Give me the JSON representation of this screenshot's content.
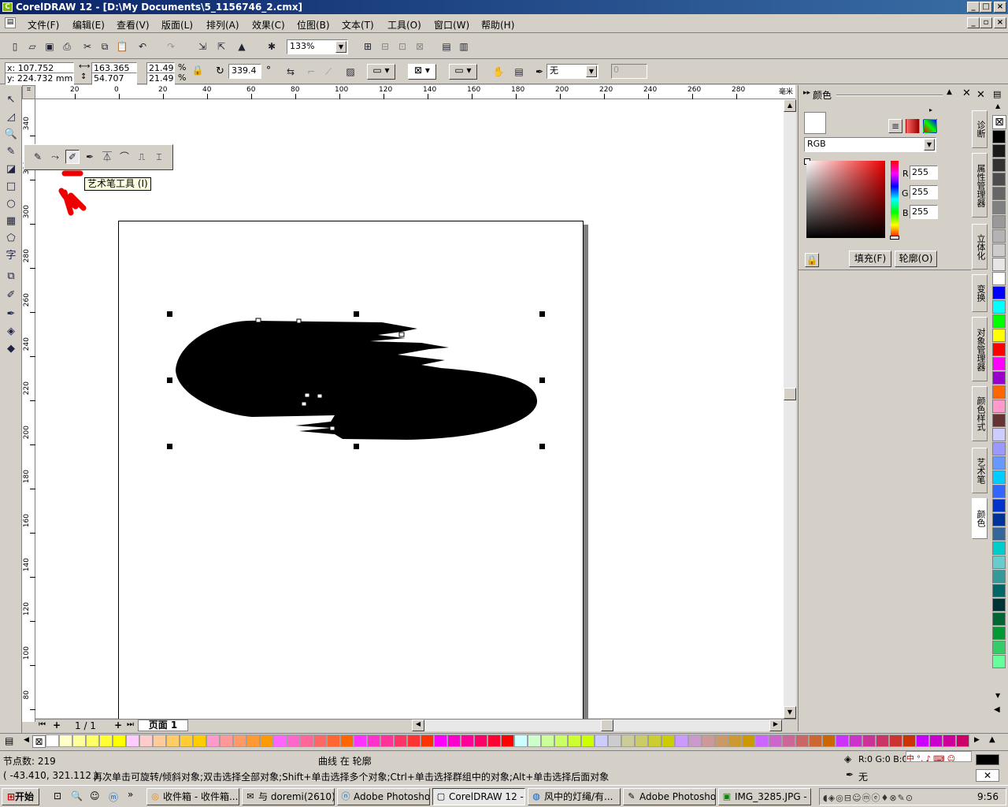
{
  "window": {
    "title": "CorelDRAW 12 - [D:\\My Documents\\5_1156746_2.cmx]"
  },
  "menu": [
    "文件(F)",
    "编辑(E)",
    "查看(V)",
    "版面(L)",
    "排列(A)",
    "效果(C)",
    "位图(B)",
    "文本(T)",
    "工具(O)",
    "窗口(W)",
    "帮助(H)"
  ],
  "toolbar": {
    "zoom": "133%"
  },
  "propbar": {
    "x": "x: 107.752 mm",
    "y": "y: 224.732 mm",
    "w": "163.365 mm",
    "h": "54.707 mm",
    "sx": "21.49",
    "sy": "21.49",
    "pct1": "%",
    "pct2": "%",
    "angle": "339.4",
    "deg": "°",
    "outline": "无",
    "disabled_val": "0"
  },
  "ruler": {
    "unit": "毫米",
    "h_ticks": [
      "20",
      "0",
      "20",
      "40",
      "60",
      "80",
      "100",
      "120",
      "140",
      "160",
      "180",
      "200",
      "220",
      "240",
      "260",
      "280"
    ],
    "v_ticks": [
      "340",
      "320",
      "300",
      "280",
      "260",
      "240",
      "220",
      "200",
      "180",
      "160",
      "140",
      "120",
      "100",
      "80"
    ]
  },
  "tooltip": "艺术笔工具 (I)",
  "page_nav": {
    "count": "1 / 1",
    "tab": "页面 1"
  },
  "docker": {
    "title": "颜色",
    "model": "RGB",
    "r_label": "R",
    "g_label": "G",
    "b_label": "B",
    "r": "255",
    "g": "255",
    "b": "255",
    "fill_btn": "填充(F)",
    "outline_btn": "轮廓(O)"
  },
  "dock_tabs": [
    "诊断",
    "属性管理器",
    "立体化",
    "变换",
    "对象管理器",
    "颜色样式",
    "艺术笔",
    "颜色"
  ],
  "status": {
    "nodes": "节点数: 219",
    "object": "曲线 在 轮廓",
    "coords": "( -43.410, 321.112 )",
    "hint": "再次单击可旋转/倾斜对象;双击选择全部对象;Shift+单击选择多个对象;Ctrl+单击选择群组中的对象;Alt+单击选择后面对象",
    "fill_info": "R:0 G:0 B:0",
    "outline_info": "无"
  },
  "taskbar": {
    "start": "开始",
    "tasks": [
      "收件箱 - 收件箱...",
      "与 doremi(2610) ...",
      "Adobe Photosho...",
      "CorelDRAW 12 - ...",
      "风中的灯绳/有...",
      "Adobe Photosho...",
      "IMG_3285.JPG - ..."
    ],
    "time": "9:56"
  },
  "colors": {
    "titlebar": "#0a246a",
    "right_palette": [
      "#000000",
      "#1a1a1a",
      "#333333",
      "#4d4d4d",
      "#666666",
      "#808080",
      "#999999",
      "#b3b3b3",
      "#cccccc",
      "#e6e6e6",
      "#ffffff",
      "#0000ff",
      "#00ffff",
      "#00ff00",
      "#ffff00",
      "#ff0000",
      "#ff00ff",
      "#9900cc",
      "#ff6600",
      "#ff99cc",
      "#663333",
      "#ccccff",
      "#9999ff",
      "#6699ff",
      "#00ccff",
      "#3366ff",
      "#0033cc",
      "#003399",
      "#336699",
      "#00cccc",
      "#66cccc",
      "#339999",
      "#006666",
      "#003333",
      "#006633",
      "#009933",
      "#33cc66",
      "#66ff99"
    ],
    "bottom_palette": [
      "#ffffff",
      "#ffffcc",
      "#ffff99",
      "#ffff66",
      "#ffff33",
      "#ffff00",
      "#ffccff",
      "#ffcccc",
      "#ffcc99",
      "#ffcc66",
      "#ffcc33",
      "#ffcc00",
      "#ff99cc",
      "#ff9999",
      "#ff9966",
      "#ff9933",
      "#ff9900",
      "#ff66ff",
      "#ff66cc",
      "#ff6699",
      "#ff6666",
      "#ff6633",
      "#ff6600",
      "#ff33ff",
      "#ff33cc",
      "#ff3399",
      "#ff3366",
      "#ff3333",
      "#ff3300",
      "#ff00ff",
      "#ff00cc",
      "#ff0099",
      "#ff0066",
      "#ff0033",
      "#ff0000",
      "#ccffff",
      "#ccffcc",
      "#ccff99",
      "#ccff66",
      "#ccff33",
      "#ccff00",
      "#ccccff",
      "#cccccc",
      "#cccc99",
      "#cccc66",
      "#cccc33",
      "#cccc00",
      "#cc99ff",
      "#cc99cc",
      "#cc9999",
      "#cc9966",
      "#cc9933",
      "#cc9900",
      "#cc66ff",
      "#cc66cc",
      "#cc6699",
      "#cc6666",
      "#cc6633",
      "#cc6600",
      "#cc33ff",
      "#cc33cc",
      "#cc3399",
      "#cc3366",
      "#cc3333",
      "#cc3300",
      "#cc00ff",
      "#cc00cc",
      "#cc0099",
      "#cc0066"
    ]
  }
}
